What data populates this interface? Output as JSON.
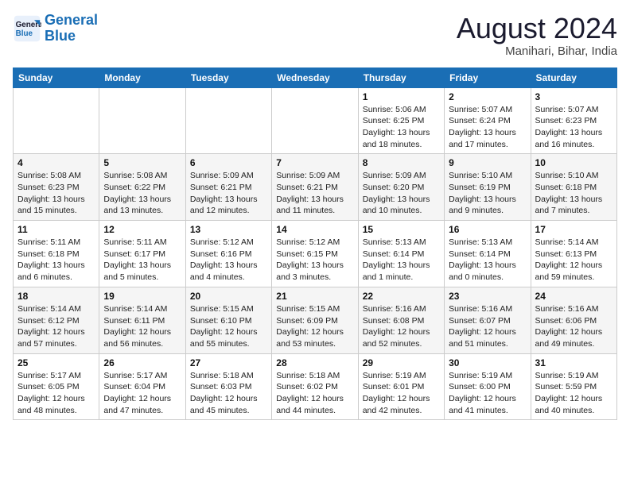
{
  "logo": {
    "line1": "General",
    "line2": "Blue"
  },
  "title": "August 2024",
  "subtitle": "Manihari, Bihar, India",
  "days_of_week": [
    "Sunday",
    "Monday",
    "Tuesday",
    "Wednesday",
    "Thursday",
    "Friday",
    "Saturday"
  ],
  "weeks": [
    [
      {
        "day": "",
        "info": ""
      },
      {
        "day": "",
        "info": ""
      },
      {
        "day": "",
        "info": ""
      },
      {
        "day": "",
        "info": ""
      },
      {
        "day": "1",
        "info": "Sunrise: 5:06 AM\nSunset: 6:25 PM\nDaylight: 13 hours\nand 18 minutes."
      },
      {
        "day": "2",
        "info": "Sunrise: 5:07 AM\nSunset: 6:24 PM\nDaylight: 13 hours\nand 17 minutes."
      },
      {
        "day": "3",
        "info": "Sunrise: 5:07 AM\nSunset: 6:23 PM\nDaylight: 13 hours\nand 16 minutes."
      }
    ],
    [
      {
        "day": "4",
        "info": "Sunrise: 5:08 AM\nSunset: 6:23 PM\nDaylight: 13 hours\nand 15 minutes."
      },
      {
        "day": "5",
        "info": "Sunrise: 5:08 AM\nSunset: 6:22 PM\nDaylight: 13 hours\nand 13 minutes."
      },
      {
        "day": "6",
        "info": "Sunrise: 5:09 AM\nSunset: 6:21 PM\nDaylight: 13 hours\nand 12 minutes."
      },
      {
        "day": "7",
        "info": "Sunrise: 5:09 AM\nSunset: 6:21 PM\nDaylight: 13 hours\nand 11 minutes."
      },
      {
        "day": "8",
        "info": "Sunrise: 5:09 AM\nSunset: 6:20 PM\nDaylight: 13 hours\nand 10 minutes."
      },
      {
        "day": "9",
        "info": "Sunrise: 5:10 AM\nSunset: 6:19 PM\nDaylight: 13 hours\nand 9 minutes."
      },
      {
        "day": "10",
        "info": "Sunrise: 5:10 AM\nSunset: 6:18 PM\nDaylight: 13 hours\nand 7 minutes."
      }
    ],
    [
      {
        "day": "11",
        "info": "Sunrise: 5:11 AM\nSunset: 6:18 PM\nDaylight: 13 hours\nand 6 minutes."
      },
      {
        "day": "12",
        "info": "Sunrise: 5:11 AM\nSunset: 6:17 PM\nDaylight: 13 hours\nand 5 minutes."
      },
      {
        "day": "13",
        "info": "Sunrise: 5:12 AM\nSunset: 6:16 PM\nDaylight: 13 hours\nand 4 minutes."
      },
      {
        "day": "14",
        "info": "Sunrise: 5:12 AM\nSunset: 6:15 PM\nDaylight: 13 hours\nand 3 minutes."
      },
      {
        "day": "15",
        "info": "Sunrise: 5:13 AM\nSunset: 6:14 PM\nDaylight: 13 hours\nand 1 minute."
      },
      {
        "day": "16",
        "info": "Sunrise: 5:13 AM\nSunset: 6:14 PM\nDaylight: 13 hours\nand 0 minutes."
      },
      {
        "day": "17",
        "info": "Sunrise: 5:14 AM\nSunset: 6:13 PM\nDaylight: 12 hours\nand 59 minutes."
      }
    ],
    [
      {
        "day": "18",
        "info": "Sunrise: 5:14 AM\nSunset: 6:12 PM\nDaylight: 12 hours\nand 57 minutes."
      },
      {
        "day": "19",
        "info": "Sunrise: 5:14 AM\nSunset: 6:11 PM\nDaylight: 12 hours\nand 56 minutes."
      },
      {
        "day": "20",
        "info": "Sunrise: 5:15 AM\nSunset: 6:10 PM\nDaylight: 12 hours\nand 55 minutes."
      },
      {
        "day": "21",
        "info": "Sunrise: 5:15 AM\nSunset: 6:09 PM\nDaylight: 12 hours\nand 53 minutes."
      },
      {
        "day": "22",
        "info": "Sunrise: 5:16 AM\nSunset: 6:08 PM\nDaylight: 12 hours\nand 52 minutes."
      },
      {
        "day": "23",
        "info": "Sunrise: 5:16 AM\nSunset: 6:07 PM\nDaylight: 12 hours\nand 51 minutes."
      },
      {
        "day": "24",
        "info": "Sunrise: 5:16 AM\nSunset: 6:06 PM\nDaylight: 12 hours\nand 49 minutes."
      }
    ],
    [
      {
        "day": "25",
        "info": "Sunrise: 5:17 AM\nSunset: 6:05 PM\nDaylight: 12 hours\nand 48 minutes."
      },
      {
        "day": "26",
        "info": "Sunrise: 5:17 AM\nSunset: 6:04 PM\nDaylight: 12 hours\nand 47 minutes."
      },
      {
        "day": "27",
        "info": "Sunrise: 5:18 AM\nSunset: 6:03 PM\nDaylight: 12 hours\nand 45 minutes."
      },
      {
        "day": "28",
        "info": "Sunrise: 5:18 AM\nSunset: 6:02 PM\nDaylight: 12 hours\nand 44 minutes."
      },
      {
        "day": "29",
        "info": "Sunrise: 5:19 AM\nSunset: 6:01 PM\nDaylight: 12 hours\nand 42 minutes."
      },
      {
        "day": "30",
        "info": "Sunrise: 5:19 AM\nSunset: 6:00 PM\nDaylight: 12 hours\nand 41 minutes."
      },
      {
        "day": "31",
        "info": "Sunrise: 5:19 AM\nSunset: 5:59 PM\nDaylight: 12 hours\nand 40 minutes."
      }
    ]
  ]
}
